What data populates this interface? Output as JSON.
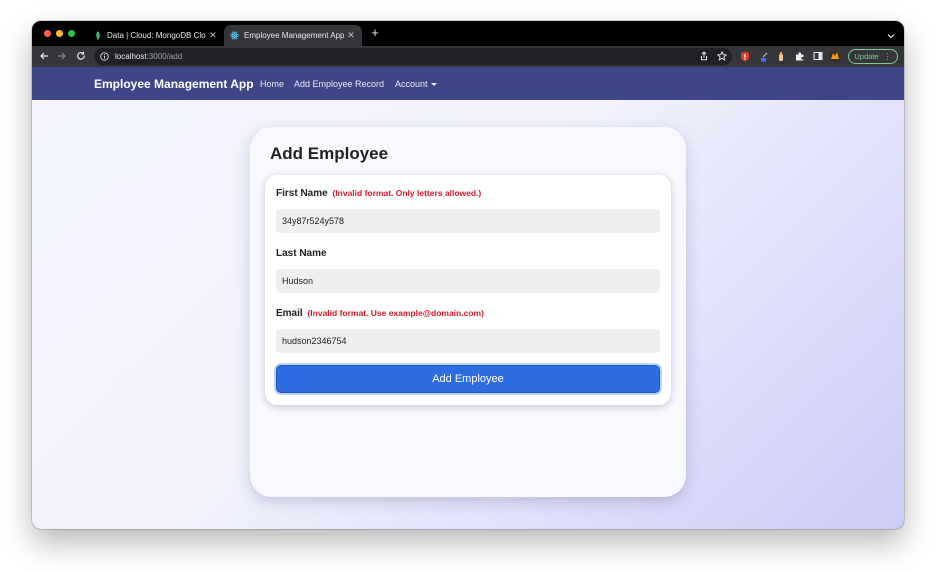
{
  "browser": {
    "tabs": [
      {
        "title": "Data | Cloud: MongoDB Cloud",
        "favicon": "leaf-icon",
        "active": false
      },
      {
        "title": "Employee Management App",
        "favicon": "react-icon",
        "active": true
      }
    ],
    "url": {
      "host": "localhost",
      "path": ":3000/add"
    },
    "update_label": "Update",
    "accent_update": "#81c995"
  },
  "navbar": {
    "brand": "Employee Management App",
    "links": [
      "Home",
      "Add Employee Record",
      "Account"
    ],
    "background": "#3d4788"
  },
  "form": {
    "title": "Add Employee",
    "fields": {
      "first_name": {
        "label": "First Name",
        "error": "(Invalid format. Only letters allowed.)",
        "value": "34y87r524y578"
      },
      "last_name": {
        "label": "Last Name",
        "value": "Hudson"
      },
      "email": {
        "label": "Email",
        "error": "(Invalid format. Use example@domain.com)",
        "value": "hudson2346754"
      }
    },
    "submit_label": "Add Employee",
    "error_color": "#d61a2c",
    "button_color": "#2d6be0"
  }
}
